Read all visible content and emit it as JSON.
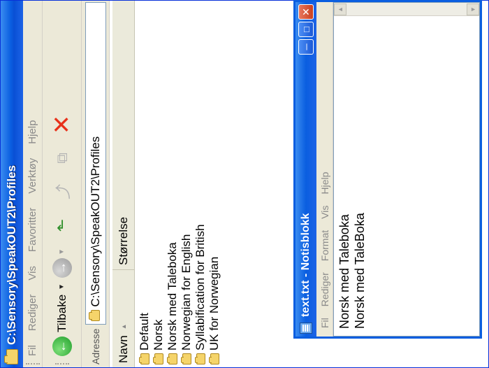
{
  "explorer": {
    "title": "C:\\Sensory\\SpeakOUT2\\Profiles",
    "menu": [
      "Fil",
      "Rediger",
      "Vis",
      "Favoritter",
      "Verktøy",
      "Hjelp"
    ],
    "toolbar": {
      "back_label": "Tilbake"
    },
    "address": {
      "label": "Adresse",
      "value": "C:\\Sensory\\SpeakOUT2\\Profiles"
    },
    "columns": {
      "name": "Navn",
      "size": "Størrelse"
    },
    "files": [
      "Default",
      "Norsk",
      "Norsk med Taleboka",
      "Norwegian for English",
      "Syllabification for British",
      "UK for Norwegian"
    ]
  },
  "notepad": {
    "title": "text.txt - Notisblokk",
    "menu": [
      "Fil",
      "Rediger",
      "Format",
      "Vis",
      "Hjelp"
    ],
    "lines": [
      "Norsk med Taleboka",
      "Norsk med TaleBoka"
    ]
  },
  "icons": {
    "back": "back-arrow-icon",
    "forward": "forward-arrow-icon",
    "up": "folder-up-icon",
    "move": "move-to-icon",
    "copy": "copy-to-icon",
    "delete": "delete-icon",
    "folder": "folder-icon"
  },
  "colors": {
    "titlebar": "#0a5ee0",
    "delete": "#e8311a",
    "back": "#1f9e2a"
  }
}
